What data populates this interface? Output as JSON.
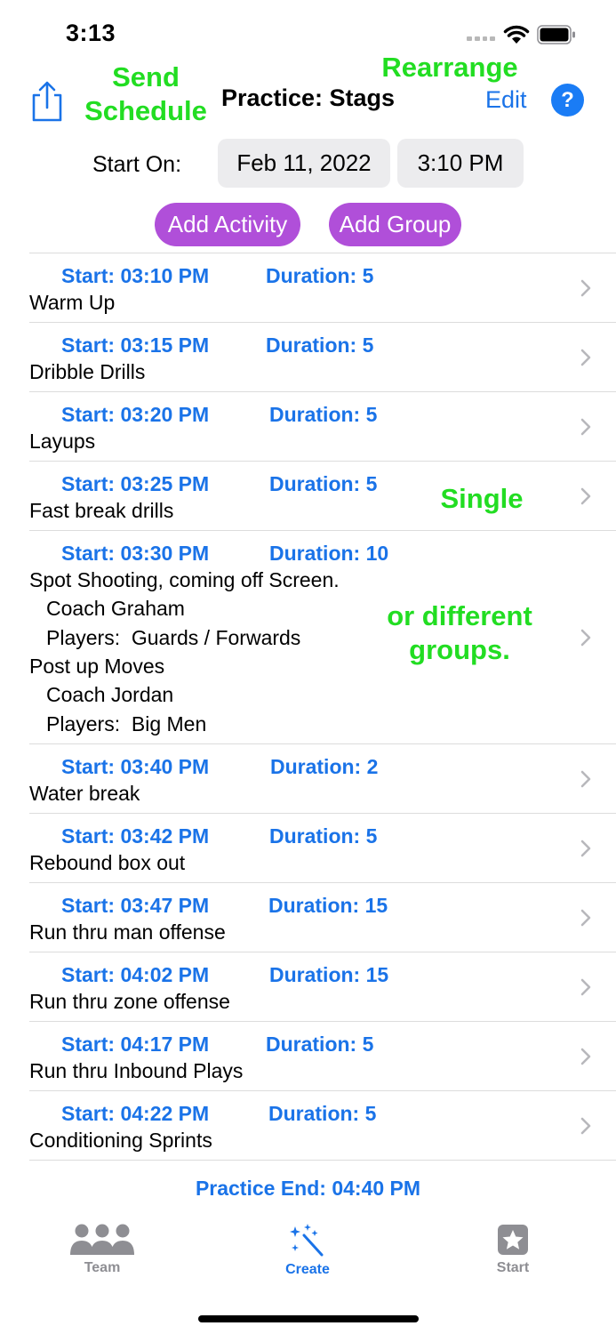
{
  "status_bar": {
    "time": "3:13"
  },
  "header": {
    "title": "Practice: Stags",
    "edit_label": "Edit",
    "help_label": "?"
  },
  "annotations": {
    "send_schedule": "Send Schedule",
    "rearrange": "Rearrange",
    "single": "Single",
    "different_groups": "or different groups."
  },
  "start_on": {
    "label": "Start On:",
    "date": "Feb 11, 2022",
    "time": "3:10 PM"
  },
  "actions": {
    "add_activity": "Add Activity",
    "add_group": "Add Group"
  },
  "activities": [
    {
      "start": "Start: 03:10 PM",
      "duration": "Duration: 5",
      "name": "Warm Up"
    },
    {
      "start": "Start: 03:15 PM",
      "duration": "Duration: 5",
      "name": "Dribble Drills"
    },
    {
      "start": "Start: 03:20 PM",
      "duration": "Duration: 5",
      "name": "Layups"
    },
    {
      "start": "Start: 03:25 PM",
      "duration": "Duration: 5",
      "name": "Fast break drills"
    },
    {
      "start": "Start: 03:30 PM",
      "duration": "Duration: 10",
      "groups": [
        {
          "activity": "Spot Shooting, coming off Screen.",
          "coach": "Coach Graham",
          "players": "Players:  Guards / Forwards"
        },
        {
          "activity": "Post up Moves",
          "coach": "Coach Jordan",
          "players": "Players:  Big Men"
        }
      ]
    },
    {
      "start": "Start: 03:40 PM",
      "duration": "Duration: 2",
      "name": "Water break"
    },
    {
      "start": "Start: 03:42 PM",
      "duration": "Duration: 5",
      "name": "Rebound box out"
    },
    {
      "start": "Start: 03:47 PM",
      "duration": "Duration: 15",
      "name": "Run thru man offense"
    },
    {
      "start": "Start: 04:02 PM",
      "duration": "Duration: 15",
      "name": "Run thru zone offense"
    },
    {
      "start": "Start: 04:17 PM",
      "duration": "Duration: 5",
      "name": "Run thru Inbound Plays"
    },
    {
      "start": "Start: 04:22 PM",
      "duration": "Duration: 5",
      "name": "Conditioning Sprints"
    }
  ],
  "practice_end": "Practice End: 04:40 PM",
  "tab_bar": {
    "team": "Team",
    "create": "Create",
    "start": "Start"
  },
  "colors": {
    "accent": "#1a73e8",
    "annotation": "#22dd22",
    "action_button": "#b04fd9"
  },
  "icons": {
    "share": "share-icon",
    "help": "help-icon",
    "chevron": "chevron-right-icon",
    "team": "team-icon",
    "create": "magic-wand-icon",
    "start": "star-icon"
  }
}
